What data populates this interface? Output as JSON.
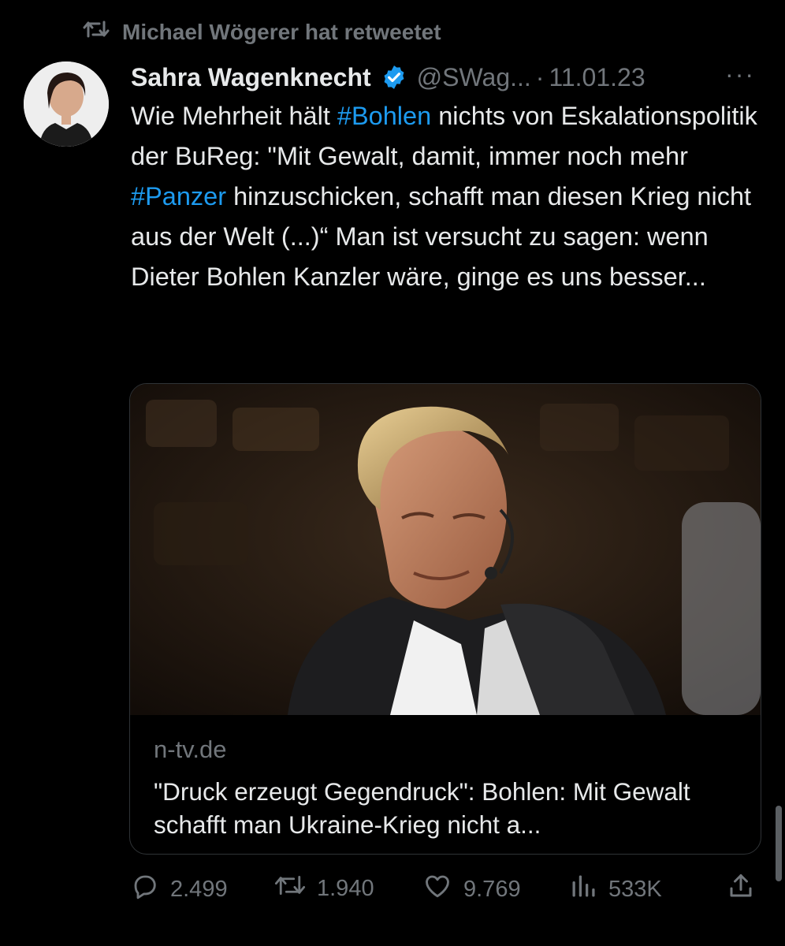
{
  "retweet": {
    "label": "Michael Wögerer hat retweetet"
  },
  "tweet": {
    "author_name": "Sahra Wagenknecht",
    "handle": "@SWag...",
    "separator": "·",
    "date": "11.01.23",
    "more_label": "···",
    "text_segments": [
      {
        "text": "Wie Mehrheit hält ",
        "type": "text"
      },
      {
        "text": "#Bohlen",
        "type": "hashtag"
      },
      {
        "text": " nichts von Eskalationspolitik der BuReg: \"Mit Gewalt, damit, immer noch mehr ",
        "type": "text"
      },
      {
        "text": "#Panzer",
        "type": "hashtag"
      },
      {
        "text": " hinzuschicken, schafft man diesen Krieg nicht aus der Welt (...)“ Man ist versucht zu sagen: wenn Dieter Bohlen Kanzler wäre, ginge es uns besser...",
        "type": "text"
      }
    ]
  },
  "card": {
    "domain": "n-tv.de",
    "title": "\"Druck erzeugt Gegendruck\": Bohlen: Mit Gewalt schafft man Ukraine-Krieg nicht a..."
  },
  "actions": {
    "replies": "2.499",
    "retweets": "1.940",
    "likes": "9.769",
    "views": "533K"
  },
  "colors": {
    "background": "#000000",
    "text": "#e7e9ea",
    "muted": "#71767b",
    "accent": "#1d9bf0",
    "border": "#2f3336"
  },
  "icons": [
    "retweet-icon",
    "verified-badge-icon",
    "more-icon",
    "reply-icon",
    "retweet-icon",
    "like-icon",
    "views-icon",
    "share-icon"
  ]
}
